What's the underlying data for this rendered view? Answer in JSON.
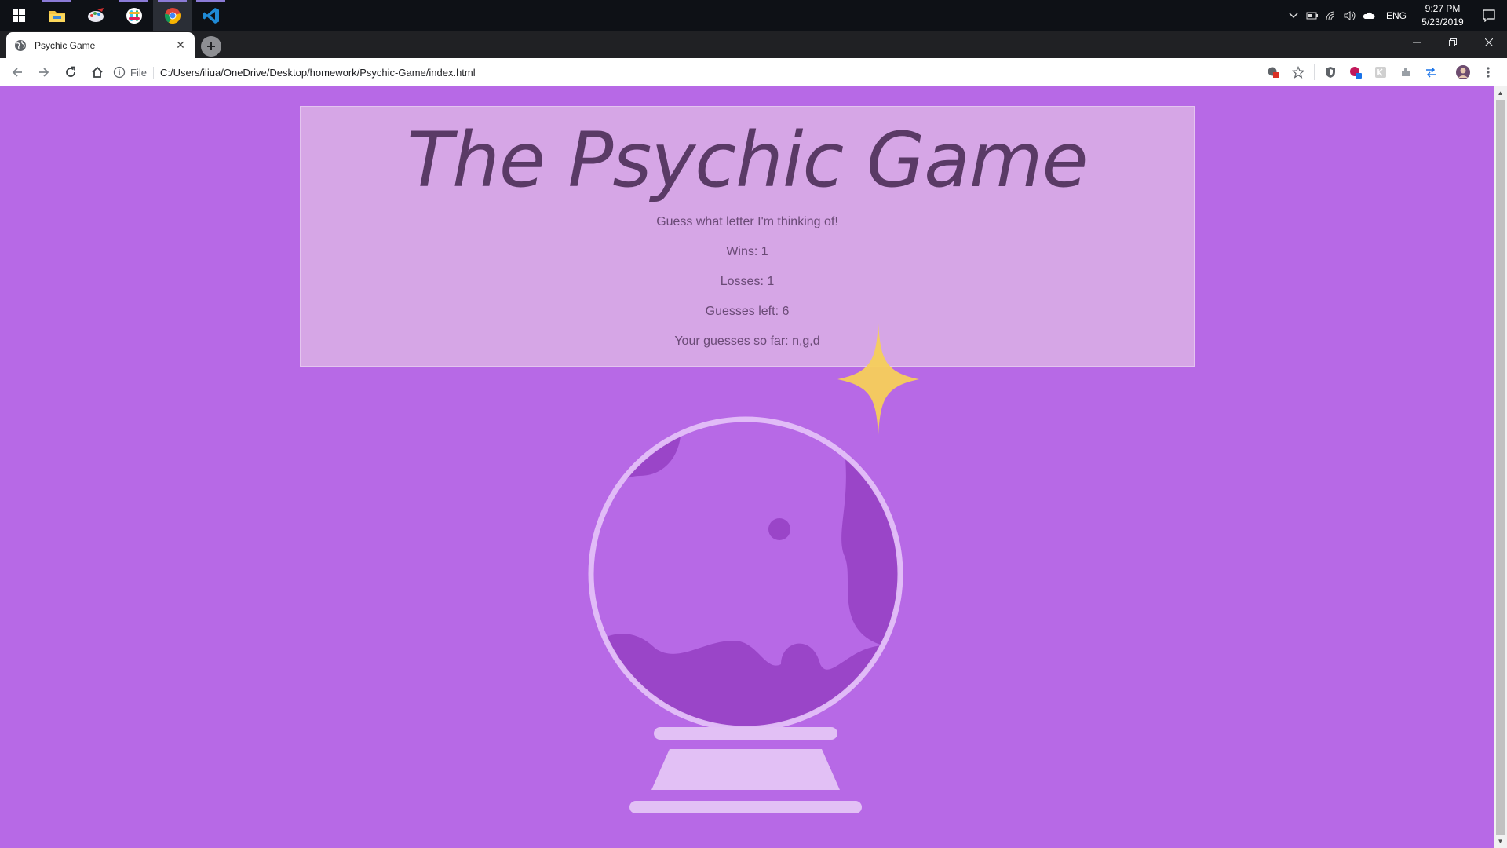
{
  "taskbar": {
    "apps": [
      {
        "name": "File Explorer",
        "icon": "folder-icon"
      },
      {
        "name": "Paint",
        "icon": "paint-icon"
      },
      {
        "name": "Slack",
        "icon": "slack-icon"
      },
      {
        "name": "Chrome",
        "icon": "chrome-icon"
      },
      {
        "name": "VS Code",
        "icon": "vscode-icon"
      }
    ],
    "language": "ENG",
    "time": "9:27 PM",
    "date": "5/23/2019"
  },
  "browser": {
    "tab_title": "Psychic Game",
    "scheme_label": "File",
    "url": "C:/Users/iliua/OneDrive/Desktop/homework/Psychic-Game/index.html"
  },
  "game": {
    "title": "The Psychic Game",
    "prompt": "Guess what letter I'm thinking of!",
    "wins": "Wins: 1",
    "losses": "Losses: 1",
    "guesses_left": "Guesses left: 6",
    "guesses_so_far": "Your guesses so far: n,g,d"
  },
  "colors": {
    "page_background": "#b769e6",
    "panel": "#d6aadd",
    "title_text": "#5a3a66",
    "orb_glass": "#e2c0f5",
    "orb_liquid": "#9a45c8",
    "sparkle": "#f5cf5a"
  }
}
